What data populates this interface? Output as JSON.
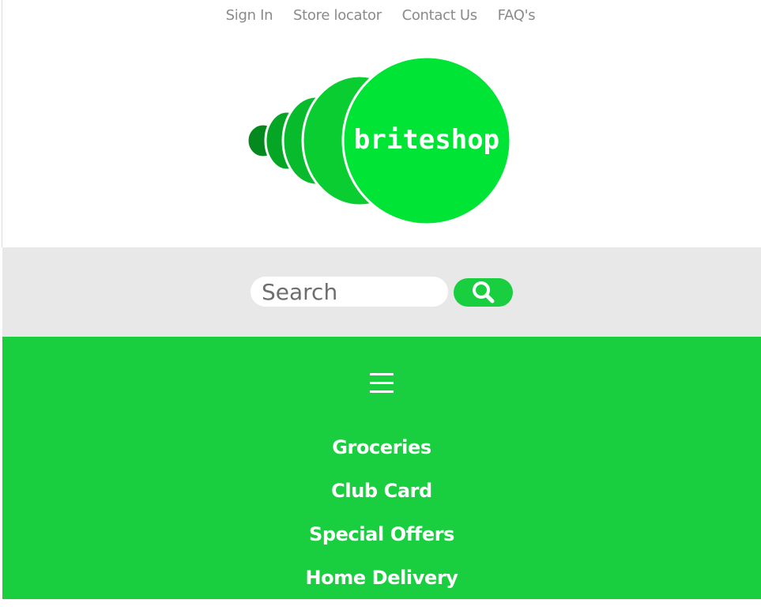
{
  "top_links": {
    "sign_in": "Sign In",
    "store_locator": "Store locator",
    "contact_us": "Contact Us",
    "faqs": "FAQ's"
  },
  "logo": {
    "text": "briteshop",
    "colors": [
      "#04891f",
      "#05a525",
      "#07bb2c",
      "#0acd32",
      "#00e535"
    ]
  },
  "search": {
    "placeholder": "Search",
    "button_icon": "search-icon"
  },
  "nav": {
    "menu_icon": "hamburger-menu-icon",
    "items": [
      {
        "label": "Groceries"
      },
      {
        "label": "Club Card"
      },
      {
        "label": "Special Offers"
      },
      {
        "label": "Home Delivery"
      }
    ]
  },
  "colors": {
    "brand_green": "#19cf3f",
    "search_band": "#e8e8e8",
    "top_link_text": "#8a8a8a",
    "nav_text": "#ffffff"
  }
}
